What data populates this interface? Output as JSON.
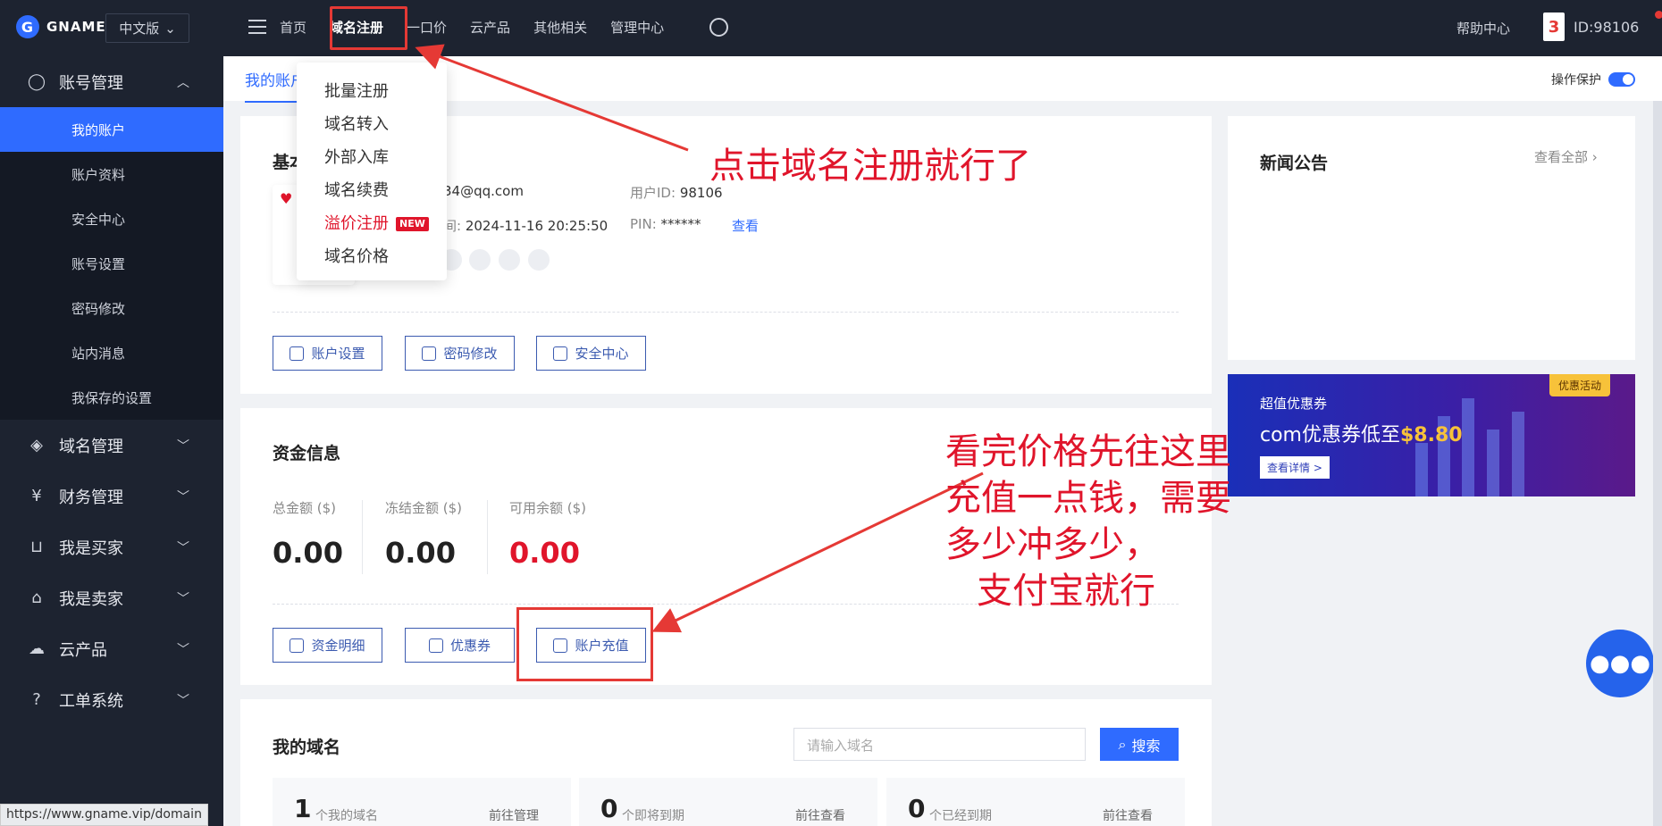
{
  "topbar": {
    "logo_text": "GNAME",
    "logo_glyph": "G",
    "lang": "中文版",
    "nav": [
      "首页",
      "域名注册",
      "一口价",
      "云产品",
      "其他相关",
      "管理中心"
    ],
    "help": "帮助中心",
    "avatar_text": "3",
    "user_id": "ID:98106"
  },
  "sidebar": {
    "account_group": "账号管理",
    "account_items": [
      "我的账户",
      "账户资料",
      "安全中心",
      "账号设置",
      "密码修改",
      "站内消息",
      "我保存的设置"
    ],
    "groups": [
      "域名管理",
      "财务管理",
      "我是买家",
      "我是卖家",
      "云产品",
      "工单系统"
    ],
    "group_icons": [
      "layers-icon",
      "finance-icon",
      "cart-icon",
      "store-icon",
      "cloud-icon",
      "question-icon"
    ]
  },
  "statusbar": {
    "url": "https://www.gname.vip/domain"
  },
  "main": {
    "tab": "我的账户",
    "protect_label": "操作保护",
    "basic": {
      "title": "基本",
      "email": "34@qq.com",
      "uid_label": "用户ID:",
      "uid_value": "98106",
      "time_label": "间:",
      "time_value": "2024-11-16 20:25:50",
      "pin_label": "PIN:",
      "pin_value": "******",
      "pin_view": "查看",
      "buttons": [
        "账户设置",
        "密码修改",
        "安全中心"
      ]
    },
    "funds": {
      "title": "资金信息",
      "items": [
        {
          "label": "总金额 ($)",
          "value": "0.00"
        },
        {
          "label": "冻结金额 ($)",
          "value": "0.00"
        },
        {
          "label": "可用余额 ($)",
          "value": "0.00"
        }
      ],
      "buttons": [
        "资金明细",
        "优惠券",
        "账户充值"
      ]
    },
    "domains": {
      "title": "我的域名",
      "search_placeholder": "请输入域名",
      "search_button": "搜索",
      "stats": [
        {
          "num": "1",
          "label": "个我的域名",
          "link": "前往管理"
        },
        {
          "num": "0",
          "label": "个即将到期",
          "link": "前往查看"
        },
        {
          "num": "0",
          "label": "个已经到期",
          "link": "前往查看"
        }
      ]
    },
    "news": {
      "title": "新闻公告",
      "more": "查看全部"
    },
    "banner": {
      "tag": "优惠活动",
      "line1": "超值优惠券",
      "line2_prefix": "com优惠券低至",
      "line2_price": "$8.80",
      "cta": "查看详情 >"
    }
  },
  "dropdown": {
    "items": [
      "批量注册",
      "域名转入",
      "外部入库",
      "域名续费",
      "溢价注册",
      "域名价格"
    ],
    "new_tag": "NEW"
  },
  "annotations": {
    "note1": "点击域名注册就行了",
    "note2": [
      "看完价格先往这里",
      "充值一点钱，需要",
      "多少冲多少，",
      "支付宝就行"
    ]
  },
  "colors": {
    "accent": "#2f6bff",
    "dark": "#1d2330",
    "annotation_red": "#e0152b"
  }
}
